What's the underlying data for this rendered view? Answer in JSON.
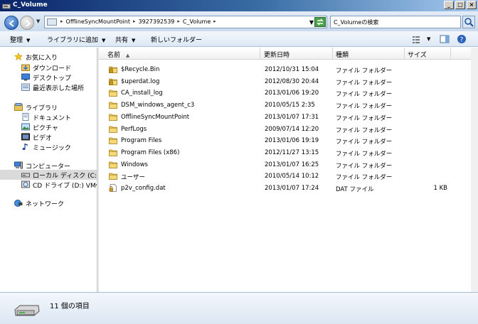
{
  "window": {
    "title": "C_Volume"
  },
  "address": {
    "breadcrumbs": [
      "OfflineSyncMountPoint",
      "3927392539",
      "C_Volume"
    ],
    "search_placeholder": "C_Volumeの検索"
  },
  "toolbar": {
    "organize": "整理",
    "include_library": "ライブラリに追加",
    "share": "共有",
    "new_folder": "新しいフォルダー"
  },
  "sidebar": {
    "favorites": {
      "label": "お気に入り",
      "items": [
        "ダウンロード",
        "デスクトップ",
        "最近表示した場所"
      ]
    },
    "libraries": {
      "label": "ライブラリ",
      "items": [
        "ドキュメント",
        "ピクチャ",
        "ビデオ",
        "ミュージック"
      ]
    },
    "computer": {
      "label": "コンピューター",
      "items": [
        "ローカル ディスク (C:)",
        "CD ドライブ (D:) VMw"
      ],
      "selected": "ローカル ディスク (C:)"
    },
    "network": {
      "label": "ネットワーク"
    }
  },
  "columns": {
    "name": "名前",
    "date": "更新日時",
    "type": "種類",
    "size": "サイズ"
  },
  "files": [
    {
      "name": "$Recycle.Bin",
      "date": "2012/10/31 15:04",
      "type": "ファイル フォルダー",
      "size": "",
      "icon": "locked-folder-icon"
    },
    {
      "name": "$uperdat.log",
      "date": "2012/08/30 20:44",
      "type": "ファイル フォルダー",
      "size": "",
      "icon": "locked-folder-icon"
    },
    {
      "name": "CA_install_log",
      "date": "2013/01/06 19:20",
      "type": "ファイル フォルダー",
      "size": "",
      "icon": "folder-icon"
    },
    {
      "name": "DSM_windows_agent_c3",
      "date": "2010/05/15 2:35",
      "type": "ファイル フォルダー",
      "size": "",
      "icon": "folder-icon"
    },
    {
      "name": "OfflineSyncMountPoint",
      "date": "2013/01/07 17:31",
      "type": "ファイル フォルダー",
      "size": "",
      "icon": "folder-icon"
    },
    {
      "name": "PerfLogs",
      "date": "2009/07/14 12:20",
      "type": "ファイル フォルダー",
      "size": "",
      "icon": "folder-icon"
    },
    {
      "name": "Program Files",
      "date": "2013/01/06 19:19",
      "type": "ファイル フォルダー",
      "size": "",
      "icon": "folder-icon"
    },
    {
      "name": "Program Files (x86)",
      "date": "2012/11/27 13:15",
      "type": "ファイル フォルダー",
      "size": "",
      "icon": "folder-icon"
    },
    {
      "name": "Windows",
      "date": "2013/01/07 16:25",
      "type": "ファイル フォルダー",
      "size": "",
      "icon": "folder-icon"
    },
    {
      "name": "ユーザー",
      "date": "2010/05/14 10:12",
      "type": "ファイル フォルダー",
      "size": "",
      "icon": "folder-icon"
    },
    {
      "name": "p2v_config.dat",
      "date": "2013/01/07 17:24",
      "type": "DAT ファイル",
      "size": "1 KB",
      "icon": "locked-file-icon"
    }
  ],
  "status": {
    "count_text": "11 個の項目"
  }
}
